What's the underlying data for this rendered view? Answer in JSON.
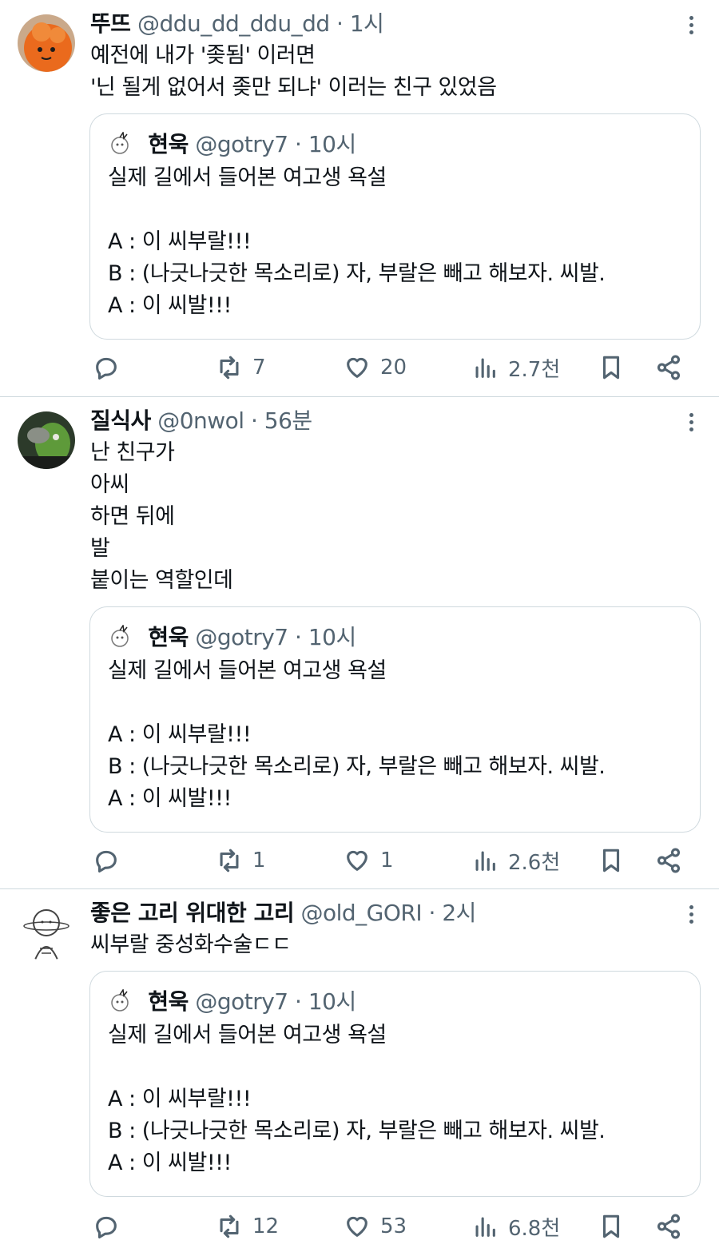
{
  "quoted": {
    "name": "현욱",
    "handle": "@gotry7",
    "separator": "·",
    "time": "10시",
    "lines": [
      "실제 길에서 들어본 여고생 욕설",
      "",
      "A : 이 씨부랄!!!",
      "B : (나긋나긋한 목소리로) 자, 부랄은 빼고 해보자. 씨발.",
      "A : 이 씨발!!!"
    ]
  },
  "tweets": [
    {
      "name": "뚜뜨",
      "handle": "@ddu_dd_ddu_dd",
      "separator": "·",
      "time": "1시",
      "lines": [
        "예전에 내가 '좆됨' 이러면",
        "'닌 될게 없어서 좆만 되냐' 이러는 친구 있었음"
      ],
      "stats": {
        "retweets": "7",
        "likes": "20",
        "views": "2.7천"
      },
      "avatar_color": "#e8661c"
    },
    {
      "name": "질식사",
      "handle": "@0nwol",
      "separator": "·",
      "time": "56분",
      "lines": [
        "난 친구가",
        "아씨",
        "하면 뒤에",
        "발",
        "붙이는 역할인데"
      ],
      "stats": {
        "retweets": "1",
        "likes": "1",
        "views": "2.6천"
      },
      "avatar_color": "#3d5a2f"
    },
    {
      "name": "좋은 고리 위대한 고리",
      "handle": "@old_GORI",
      "separator": "·",
      "time": "2시",
      "lines": [
        "씨부랄 중성화수술ㄷㄷ"
      ],
      "stats": {
        "retweets": "12",
        "likes": "53",
        "views": "6.8천"
      },
      "avatar_color": "#ffffff"
    }
  ],
  "icons": {
    "reply": "reply-icon",
    "retweet": "retweet-icon",
    "like": "heart-icon",
    "views": "views-icon",
    "bookmark": "bookmark-icon",
    "share": "share-icon",
    "more": "more-icon"
  },
  "colors": {
    "text": "#0f1419",
    "secondary": "#536471",
    "border": "#cfd9de"
  }
}
